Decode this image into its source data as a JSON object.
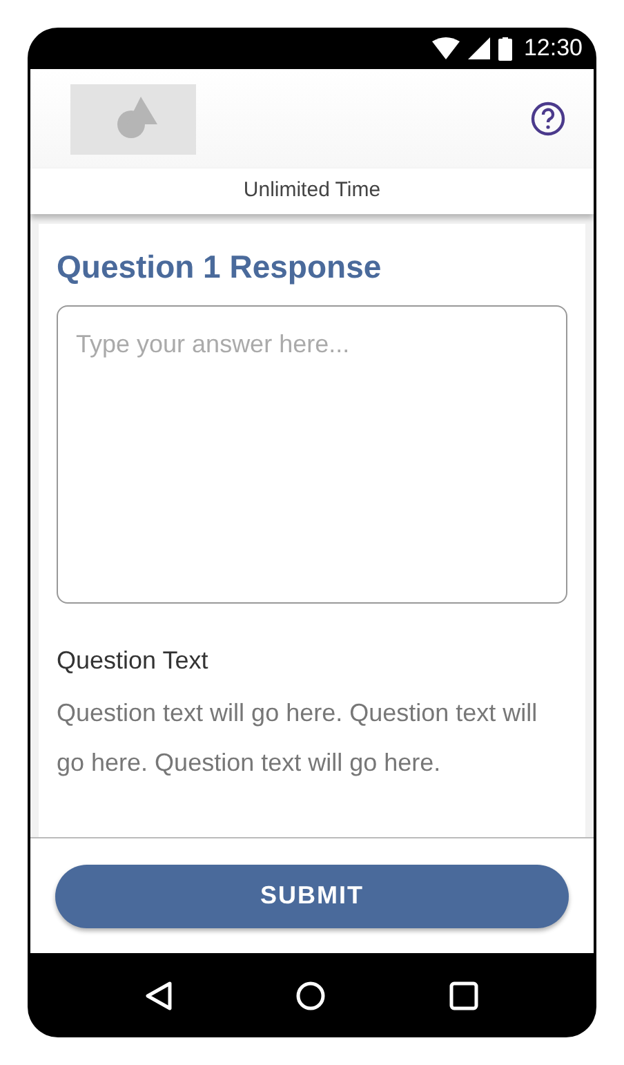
{
  "status_bar": {
    "time": "12:30"
  },
  "timer": {
    "label": "Unlimited Time"
  },
  "response": {
    "title": "Question 1 Response",
    "placeholder": "Type your answer here..."
  },
  "question": {
    "heading": "Question Text",
    "body": "Question text will go here. Question text will go here. Question text will go here."
  },
  "submit": {
    "label": "SUBMIT"
  }
}
